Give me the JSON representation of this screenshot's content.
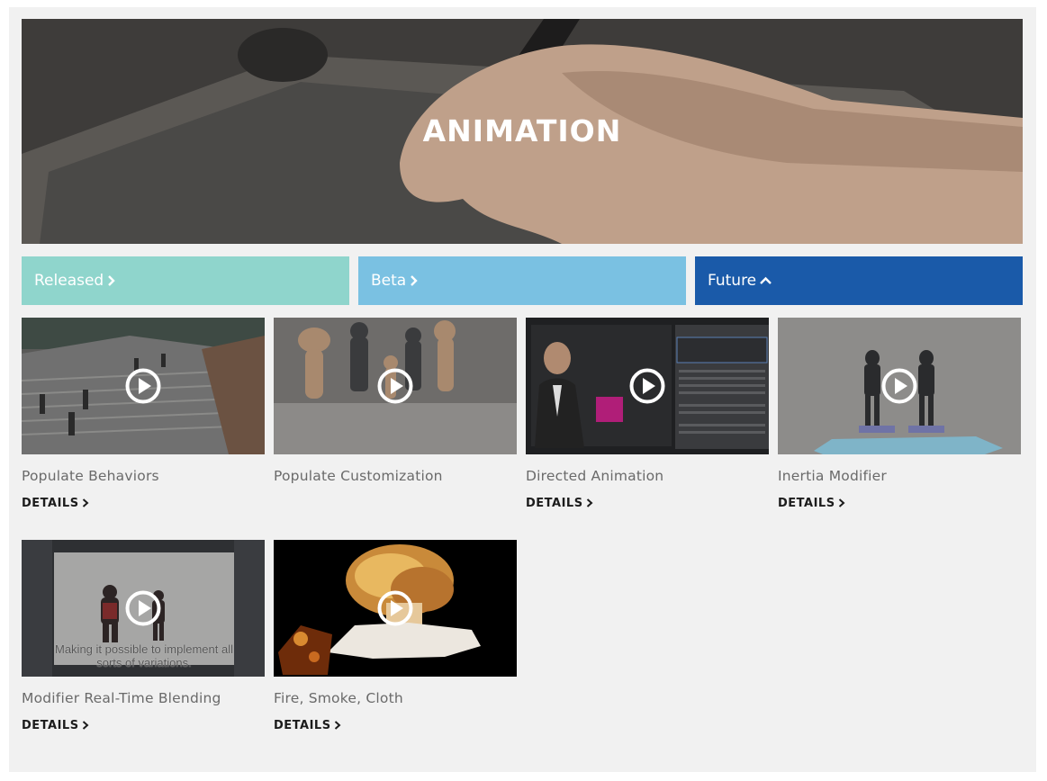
{
  "hero": {
    "title": "ANIMATION"
  },
  "tabs": [
    {
      "label": "Released",
      "icon": "chevron-right-icon",
      "color": "#8fd5cc"
    },
    {
      "label": "Beta",
      "icon": "chevron-right-icon",
      "color": "#7ac1e2"
    },
    {
      "label": "Future",
      "icon": "chevron-up-icon",
      "color": "#1a5aa9",
      "active": true
    }
  ],
  "cards": [
    {
      "title": "Populate Behaviors",
      "details": "DETAILS"
    },
    {
      "title": "Populate Customization"
    },
    {
      "title": "Directed Animation",
      "details": "DETAILS"
    },
    {
      "title": "Inertia Modifier",
      "details": "DETAILS"
    },
    {
      "title": "Modifier Real-Time Blending",
      "details": "DETAILS",
      "caption": "Making it possible to implement all sorts of variations."
    },
    {
      "title": "Fire, Smoke, Cloth",
      "details": "DETAILS"
    }
  ]
}
